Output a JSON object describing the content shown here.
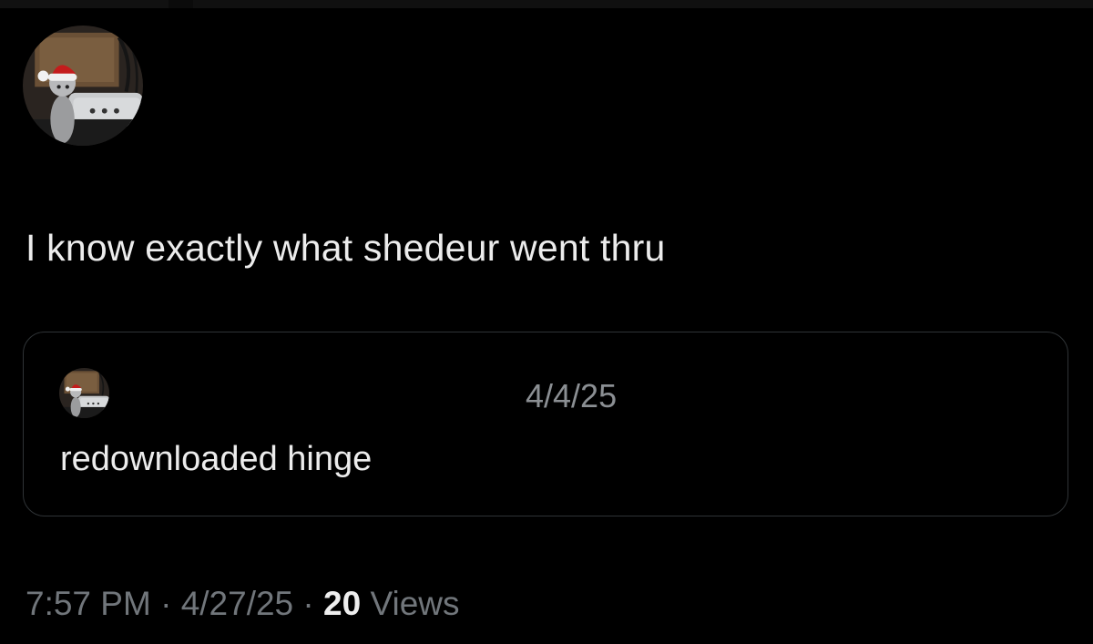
{
  "tweet": {
    "text": "I know exactly what shedeur went thru",
    "time": "7:57 PM",
    "separator": "·",
    "date": "4/27/25",
    "views_count": "20",
    "views_label": "Views"
  },
  "quoted_tweet": {
    "date": "4/4/25",
    "text": "redownloaded hinge"
  },
  "colors": {
    "background": "#000000",
    "primary_text": "#e7e9ea",
    "secondary_text": "#71767b",
    "card_border": "#2f3336"
  }
}
